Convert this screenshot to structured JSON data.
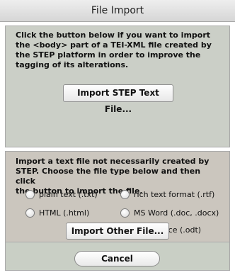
{
  "window": {
    "title": "File Import"
  },
  "step_section": {
    "description": "Click the button below if you want to import\nthe <body> part of a TEI-XML file created by\nthe STEP platform in order to improve the\ntagging of its alterations.",
    "button_label": "Import STEP Text File..."
  },
  "other_section": {
    "description": "Import a text file not necessarily created by\nSTEP. Choose the file type below and then click\nthe button to import the file.",
    "options": [
      {
        "label": "plain text (.txt)"
      },
      {
        "label": "rich text format (.rtf)"
      },
      {
        "label": "HTML (.html)"
      },
      {
        "label": "MS Word (.doc, .docx)"
      },
      {
        "label": "OpenOffice (.odt)"
      }
    ],
    "button_label": "Import Other File..."
  },
  "footer": {
    "cancel_label": "Cancel"
  }
}
